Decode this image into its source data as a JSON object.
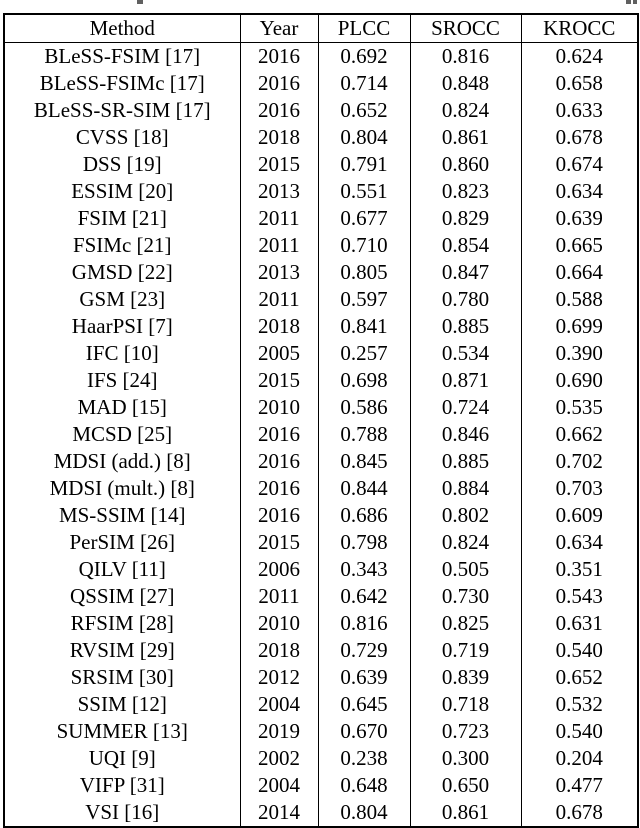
{
  "table": {
    "columns": [
      "Method",
      "Year",
      "PLCC",
      "SROCC",
      "KROCC"
    ],
    "rows": [
      {
        "method": "BLeSS-FSIM [17]",
        "year": "2016",
        "plcc": "0.692",
        "srocc": "0.816",
        "krocc": "0.624",
        "bold": []
      },
      {
        "method": "BLeSS-FSIMc [17]",
        "year": "2016",
        "plcc": "0.714",
        "srocc": "0.848",
        "krocc": "0.658",
        "bold": []
      },
      {
        "method": "BLeSS-SR-SIM [17]",
        "year": "2016",
        "plcc": "0.652",
        "srocc": "0.824",
        "krocc": "0.633",
        "bold": []
      },
      {
        "method": "CVSS [18]",
        "year": "2018",
        "plcc": "0.804",
        "srocc": "0.861",
        "krocc": "0.678",
        "bold": []
      },
      {
        "method": "DSS [19]",
        "year": "2015",
        "plcc": "0.791",
        "srocc": "0.860",
        "krocc": "0.674",
        "bold": []
      },
      {
        "method": "ESSIM [20]",
        "year": "2013",
        "plcc": "0.551",
        "srocc": "0.823",
        "krocc": "0.634",
        "bold": []
      },
      {
        "method": "FSIM [21]",
        "year": "2011",
        "plcc": "0.677",
        "srocc": "0.829",
        "krocc": "0.639",
        "bold": []
      },
      {
        "method": "FSIMc [21]",
        "year": "2011",
        "plcc": "0.710",
        "srocc": "0.854",
        "krocc": "0.665",
        "bold": []
      },
      {
        "method": "GMSD [22]",
        "year": "2013",
        "plcc": "0.805",
        "srocc": "0.847",
        "krocc": "0.664",
        "bold": []
      },
      {
        "method": "GSM [23]",
        "year": "2011",
        "plcc": "0.597",
        "srocc": "0.780",
        "krocc": "0.588",
        "bold": []
      },
      {
        "method": "HaarPSI [7]",
        "year": "2018",
        "plcc": "0.841",
        "srocc": "0.885",
        "krocc": "0.699",
        "bold": [
          "srocc"
        ]
      },
      {
        "method": "IFC [10]",
        "year": "2005",
        "plcc": "0.257",
        "srocc": "0.534",
        "krocc": "0.390",
        "bold": []
      },
      {
        "method": "IFS [24]",
        "year": "2015",
        "plcc": "0.698",
        "srocc": "0.871",
        "krocc": "0.690",
        "bold": []
      },
      {
        "method": "MAD [15]",
        "year": "2010",
        "plcc": "0.586",
        "srocc": "0.724",
        "krocc": "0.535",
        "bold": []
      },
      {
        "method": "MCSD [25]",
        "year": "2016",
        "plcc": "0.788",
        "srocc": "0.846",
        "krocc": "0.662",
        "bold": []
      },
      {
        "method": "MDSI (add.) [8]",
        "year": "2016",
        "plcc": "0.845",
        "srocc": "0.885",
        "krocc": "0.702",
        "bold": [
          "plcc",
          "srocc"
        ]
      },
      {
        "method": "MDSI (mult.) [8]",
        "year": "2016",
        "plcc": "0.844",
        "srocc": "0.884",
        "krocc": "0.703",
        "bold": [
          "krocc"
        ]
      },
      {
        "method": "MS-SSIM [14]",
        "year": "2016",
        "plcc": "0.686",
        "srocc": "0.802",
        "krocc": "0.609",
        "bold": []
      },
      {
        "method": "PerSIM [26]",
        "year": "2015",
        "plcc": "0.798",
        "srocc": "0.824",
        "krocc": "0.634",
        "bold": []
      },
      {
        "method": "QILV [11]",
        "year": "2006",
        "plcc": "0.343",
        "srocc": "0.505",
        "krocc": "0.351",
        "bold": []
      },
      {
        "method": "QSSIM [27]",
        "year": "2011",
        "plcc": "0.642",
        "srocc": "0.730",
        "krocc": "0.543",
        "bold": []
      },
      {
        "method": "RFSIM [28]",
        "year": "2010",
        "plcc": "0.816",
        "srocc": "0.825",
        "krocc": "0.631",
        "bold": []
      },
      {
        "method": "RVSIM [29]",
        "year": "2018",
        "plcc": "0.729",
        "srocc": "0.719",
        "krocc": "0.540",
        "bold": []
      },
      {
        "method": "SRSIM [30]",
        "year": "2012",
        "plcc": "0.639",
        "srocc": "0.839",
        "krocc": "0.652",
        "bold": []
      },
      {
        "method": "SSIM [12]",
        "year": "2004",
        "plcc": "0.645",
        "srocc": "0.718",
        "krocc": "0.532",
        "bold": []
      },
      {
        "method": "SUMMER [13]",
        "year": "2019",
        "plcc": "0.670",
        "srocc": "0.723",
        "krocc": "0.540",
        "bold": []
      },
      {
        "method": "UQI [9]",
        "year": "2002",
        "plcc": "0.238",
        "srocc": "0.300",
        "krocc": "0.204",
        "bold": []
      },
      {
        "method": "VIFP [31]",
        "year": "2004",
        "plcc": "0.648",
        "srocc": "0.650",
        "krocc": "0.477",
        "bold": []
      },
      {
        "method": "VSI [16]",
        "year": "2014",
        "plcc": "0.804",
        "srocc": "0.861",
        "krocc": "0.678",
        "bold": []
      }
    ]
  }
}
